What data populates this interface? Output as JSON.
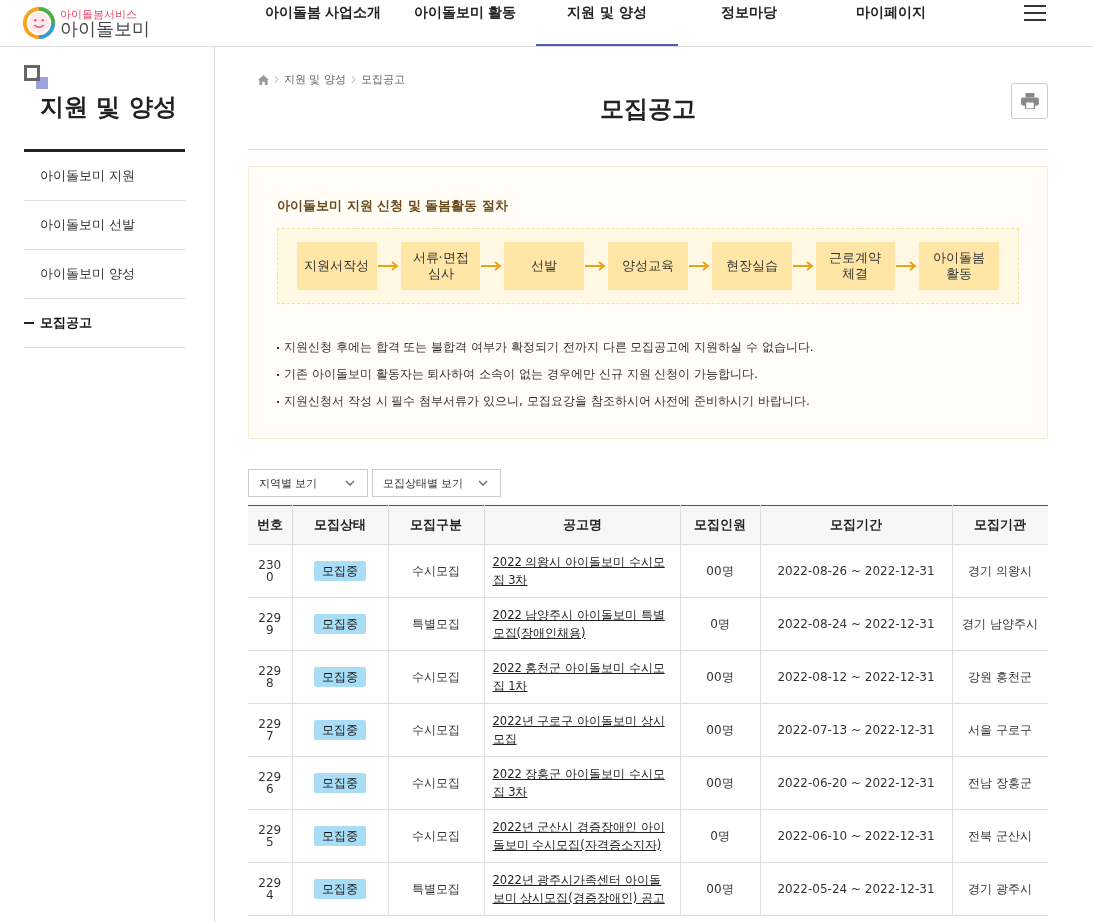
{
  "logo": {
    "tagline": "아이돌봄서비스",
    "name": "아이돌보미"
  },
  "nav": [
    {
      "label": "아이돌봄 사업소개",
      "selected": false
    },
    {
      "label": "아이돌보미 활동",
      "selected": false
    },
    {
      "label": "지원 및 양성",
      "selected": true
    },
    {
      "label": "정보마당",
      "selected": false
    },
    {
      "label": "마이페이지",
      "selected": false
    }
  ],
  "sidebar": {
    "title": "지원 및 양성",
    "items": [
      {
        "label": "아이돌보미 지원",
        "selected": false
      },
      {
        "label": "아이돌보미 선발",
        "selected": false
      },
      {
        "label": "아이돌보미 양성",
        "selected": false
      },
      {
        "label": "모집공고",
        "selected": true
      }
    ]
  },
  "breadcrumb": [
    "지원 및 양성",
    "모집공고"
  ],
  "page_title": "모집공고",
  "procedure": {
    "title": "아이돌보미 지원 신청 및 돌봄활동 절차",
    "steps": [
      "지원서작성",
      "서류·면접\n심사",
      "선발",
      "양성교육",
      "현장실습",
      "근로계약\n체결",
      "아이돌봄\n활동"
    ],
    "notes": [
      "지원신청 후에는 합격 또는 불합격 여부가 확정되기 전까지 다른 모집공고에 지원하실 수 없습니다.",
      "기존 아이돌보미 활동자는 퇴사하여 소속이 없는 경우에만 신규 지원 신청이 가능합니다.",
      "지원신청서 작성 시 필수 첨부서류가 있으니, 모집요강을 참조하시어 사전에 준비하시기 바랍니다."
    ]
  },
  "filters": [
    "지역별 보기",
    "모집상태별 보기"
  ],
  "table": {
    "columns": [
      "번호",
      "모집상태",
      "모집구분",
      "공고명",
      "모집인원",
      "모집기간",
      "모집기관"
    ],
    "rows": [
      {
        "no": "2300",
        "status": "모집중",
        "type": "수시모집",
        "title": "2022 의왕시 아이돌보미 수시모집 3차",
        "count": "00명",
        "period": "2022-08-26 ~ 2022-12-31",
        "org": "경기 의왕시"
      },
      {
        "no": "2299",
        "status": "모집중",
        "type": "특별모집",
        "title": "2022 남양주시 아이돌보미 특별모집(장애인채용)",
        "count": "0명",
        "period": "2022-08-24 ~ 2022-12-31",
        "org": "경기 남양주시"
      },
      {
        "no": "2298",
        "status": "모집중",
        "type": "수시모집",
        "title": "2022 홍천군 아이돌보미 수시모집 1차",
        "count": "00명",
        "period": "2022-08-12 ~ 2022-12-31",
        "org": "강원 홍천군"
      },
      {
        "no": "2297",
        "status": "모집중",
        "type": "수시모집",
        "title": "2022년 구로구 아이돌보미 상시 모집",
        "count": "00명",
        "period": "2022-07-13 ~ 2022-12-31",
        "org": "서울 구로구"
      },
      {
        "no": "2296",
        "status": "모집중",
        "type": "수시모집",
        "title": "2022 장흥군 아이돌보미 수시모집 3차",
        "count": "00명",
        "period": "2022-06-20 ~ 2022-12-31",
        "org": "전남 장흥군"
      },
      {
        "no": "2295",
        "status": "모집중",
        "type": "수시모집",
        "title": "2022년 군산시 경증장애인 아이돌보미 수시모집(자격증소지자)",
        "count": "0명",
        "period": "2022-06-10 ~ 2022-12-31",
        "org": "전북 군산시"
      },
      {
        "no": "2294",
        "status": "모집중",
        "type": "특별모집",
        "title": "2022년 광주시가족센터 아이돌보미 상시모집(경증장애인) 공고",
        "count": "00명",
        "period": "2022-05-24 ~ 2022-12-31",
        "org": "경기 광주시"
      }
    ]
  }
}
